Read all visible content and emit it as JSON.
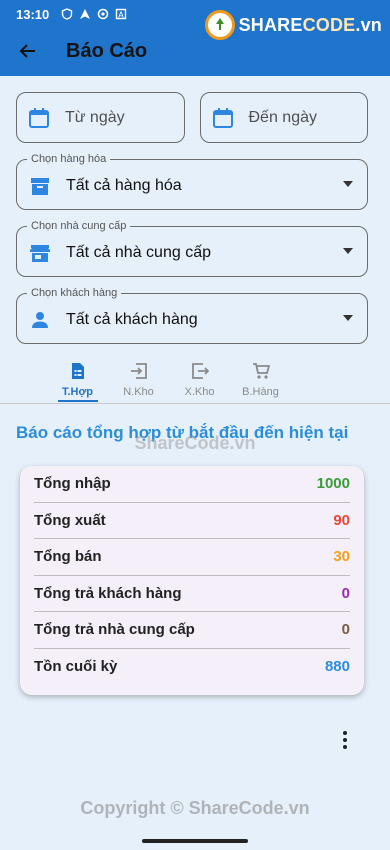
{
  "status_bar": {
    "time": "13:10"
  },
  "watermark": {
    "logo_text_a": "SHARE",
    "logo_text_b": "CODE",
    "logo_text_c": ".vn",
    "middle_text": "ShareCode.vn",
    "footer_text": "Copyright © ShareCode.vn"
  },
  "appbar": {
    "title": "Báo Cáo",
    "color": "#1f74cc"
  },
  "filters": {
    "from_date_placeholder": "Từ ngày",
    "to_date_placeholder": "Đến ngày",
    "product": {
      "label": "Chọn hàng hóa",
      "value": "Tất cả hàng hóa"
    },
    "supplier": {
      "label": "Chọn nhà cung cấp",
      "value": "Tất cả nhà cung cấp"
    },
    "customer": {
      "label": "Chọn khách hàng",
      "value": "Tất cả khách hàng"
    }
  },
  "tabs": [
    {
      "label": "T.Hợp",
      "icon": "summary-doc-icon",
      "active": true
    },
    {
      "label": "N.Kho",
      "icon": "import-icon",
      "active": false
    },
    {
      "label": "X.Kho",
      "icon": "export-icon",
      "active": false
    },
    {
      "label": "B.Hàng",
      "icon": "cart-icon",
      "active": false
    }
  ],
  "summary": {
    "title": "Báo cáo tổng hợp từ bắt đầu đến hiện tại",
    "rows": [
      {
        "label": "Tổng nhập",
        "value": "1000",
        "color": "#3a9c3a"
      },
      {
        "label": "Tổng xuất",
        "value": "90",
        "color": "#e04a3b"
      },
      {
        "label": "Tổng bán",
        "value": "30",
        "color": "#f0a21a"
      },
      {
        "label": "Tổng trả khách hàng",
        "value": "0",
        "color": "#9c2bb0"
      },
      {
        "label": "Tổng trả nhà cung cấp",
        "value": "0",
        "color": "#7a5a45"
      },
      {
        "label": "Tồn cuối kỳ",
        "value": "880",
        "color": "#2b8ed8"
      }
    ]
  },
  "colors": {
    "accent": "#1e74c8",
    "icon_blue": "#2d86e0"
  }
}
